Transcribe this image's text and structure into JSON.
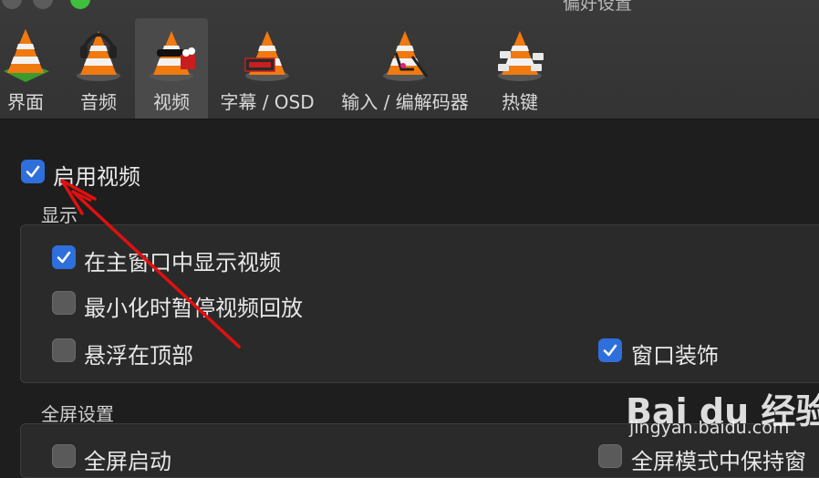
{
  "window": {
    "title": "偏好设置"
  },
  "toolbar": {
    "tabs": [
      {
        "label": "界面",
        "icon": "vlc-interface-icon"
      },
      {
        "label": "音频",
        "icon": "vlc-audio-icon"
      },
      {
        "label": "视频",
        "icon": "vlc-video-icon",
        "selected": true
      },
      {
        "label": "字幕 / OSD",
        "icon": "vlc-subtitles-icon"
      },
      {
        "label": "输入 / 编解码器",
        "icon": "vlc-input-codecs-icon"
      },
      {
        "label": "热键",
        "icon": "vlc-hotkeys-icon"
      }
    ]
  },
  "video": {
    "enable_video": {
      "label": "启用视频",
      "checked": true
    },
    "display": {
      "title": "显示",
      "show_in_main_window": {
        "label": "在主窗口中显示视频",
        "checked": true
      },
      "pause_on_minimize": {
        "label": "最小化时暂停视频回放",
        "checked": false
      },
      "float_on_top": {
        "label": "悬浮在顶部",
        "checked": false
      },
      "window_decorations": {
        "label": "窗口装饰",
        "checked": true
      }
    },
    "fullscreen": {
      "title": "全屏设置",
      "fullscreen_start": {
        "label": "全屏启动",
        "checked": false
      },
      "keep_in_fullscreen": {
        "label": "全屏模式中保持窗",
        "checked": false
      }
    }
  },
  "watermark": {
    "logo": "Bai du 经验",
    "url": "jingyan.baidu.com"
  },
  "colors": {
    "accent": "#2e6fdc",
    "annotation_arrow": "#e01010",
    "cone_orange": "#f07a10"
  }
}
